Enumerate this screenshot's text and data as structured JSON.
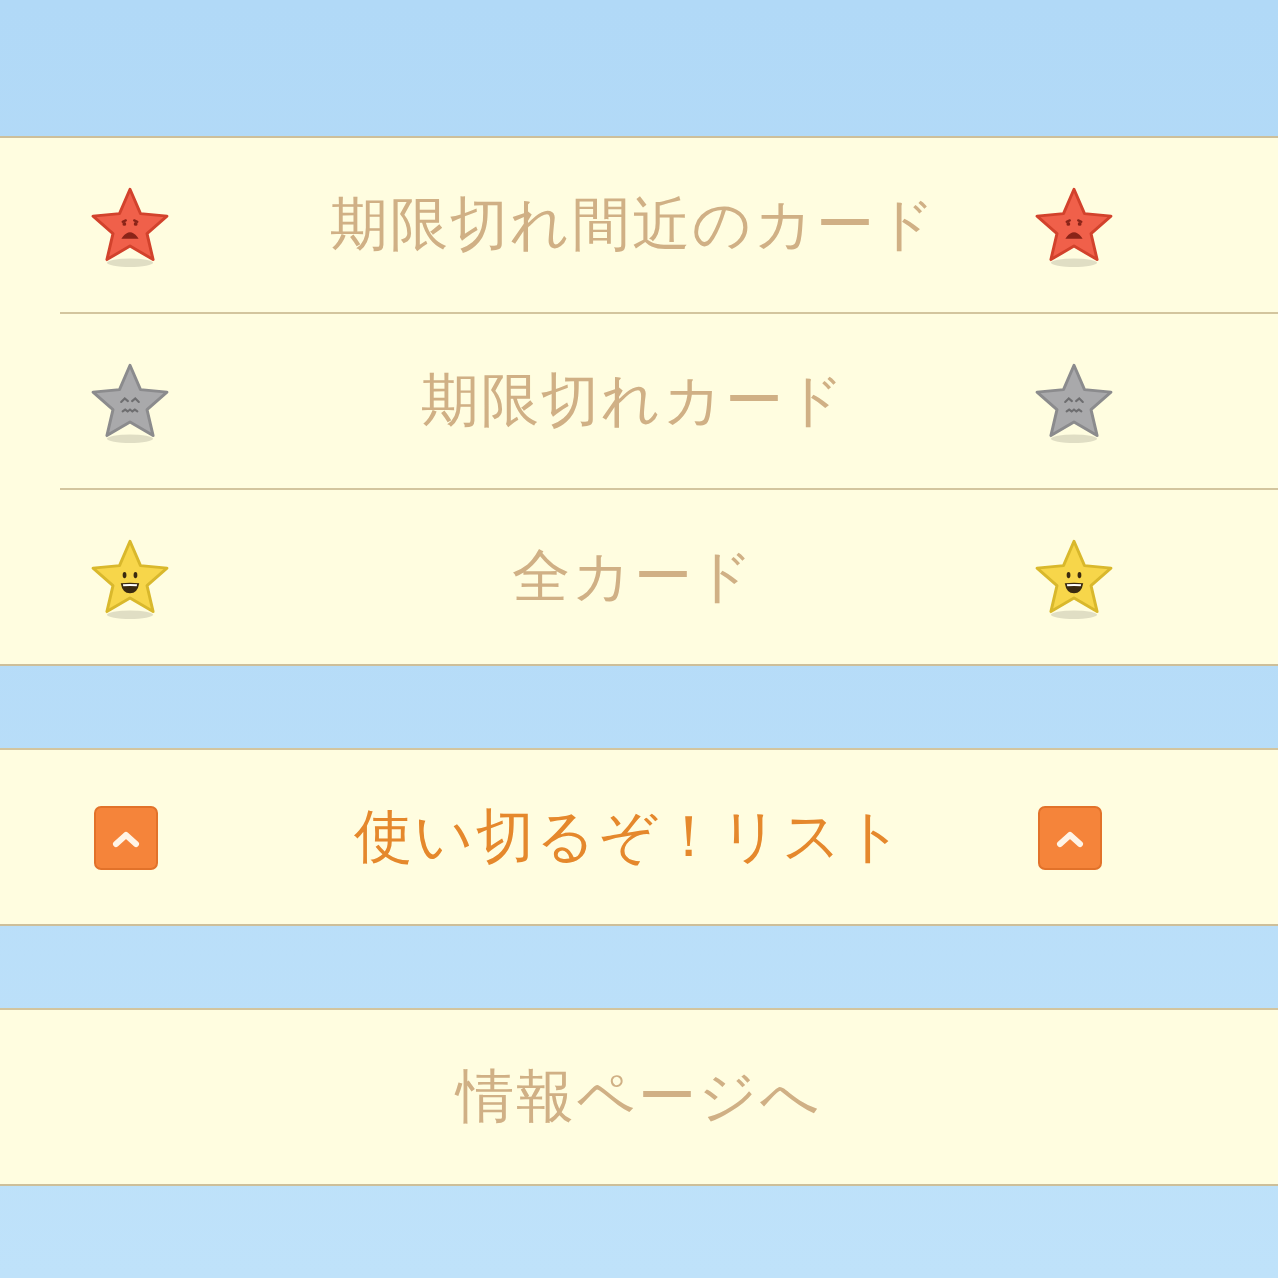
{
  "card_filters": [
    {
      "kind": "sad",
      "color": "#f0604a",
      "label": "期限切れ間近のカード"
    },
    {
      "kind": "weary",
      "color": "#a9a9ab",
      "label": "期限切れカード"
    },
    {
      "kind": "happy",
      "color": "#f7d64a",
      "label": "全カード"
    }
  ],
  "links": [
    {
      "kind": "featured",
      "label": "使い切るぞ！リスト"
    },
    {
      "kind": "plain",
      "label": "情報ページへ"
    }
  ]
}
